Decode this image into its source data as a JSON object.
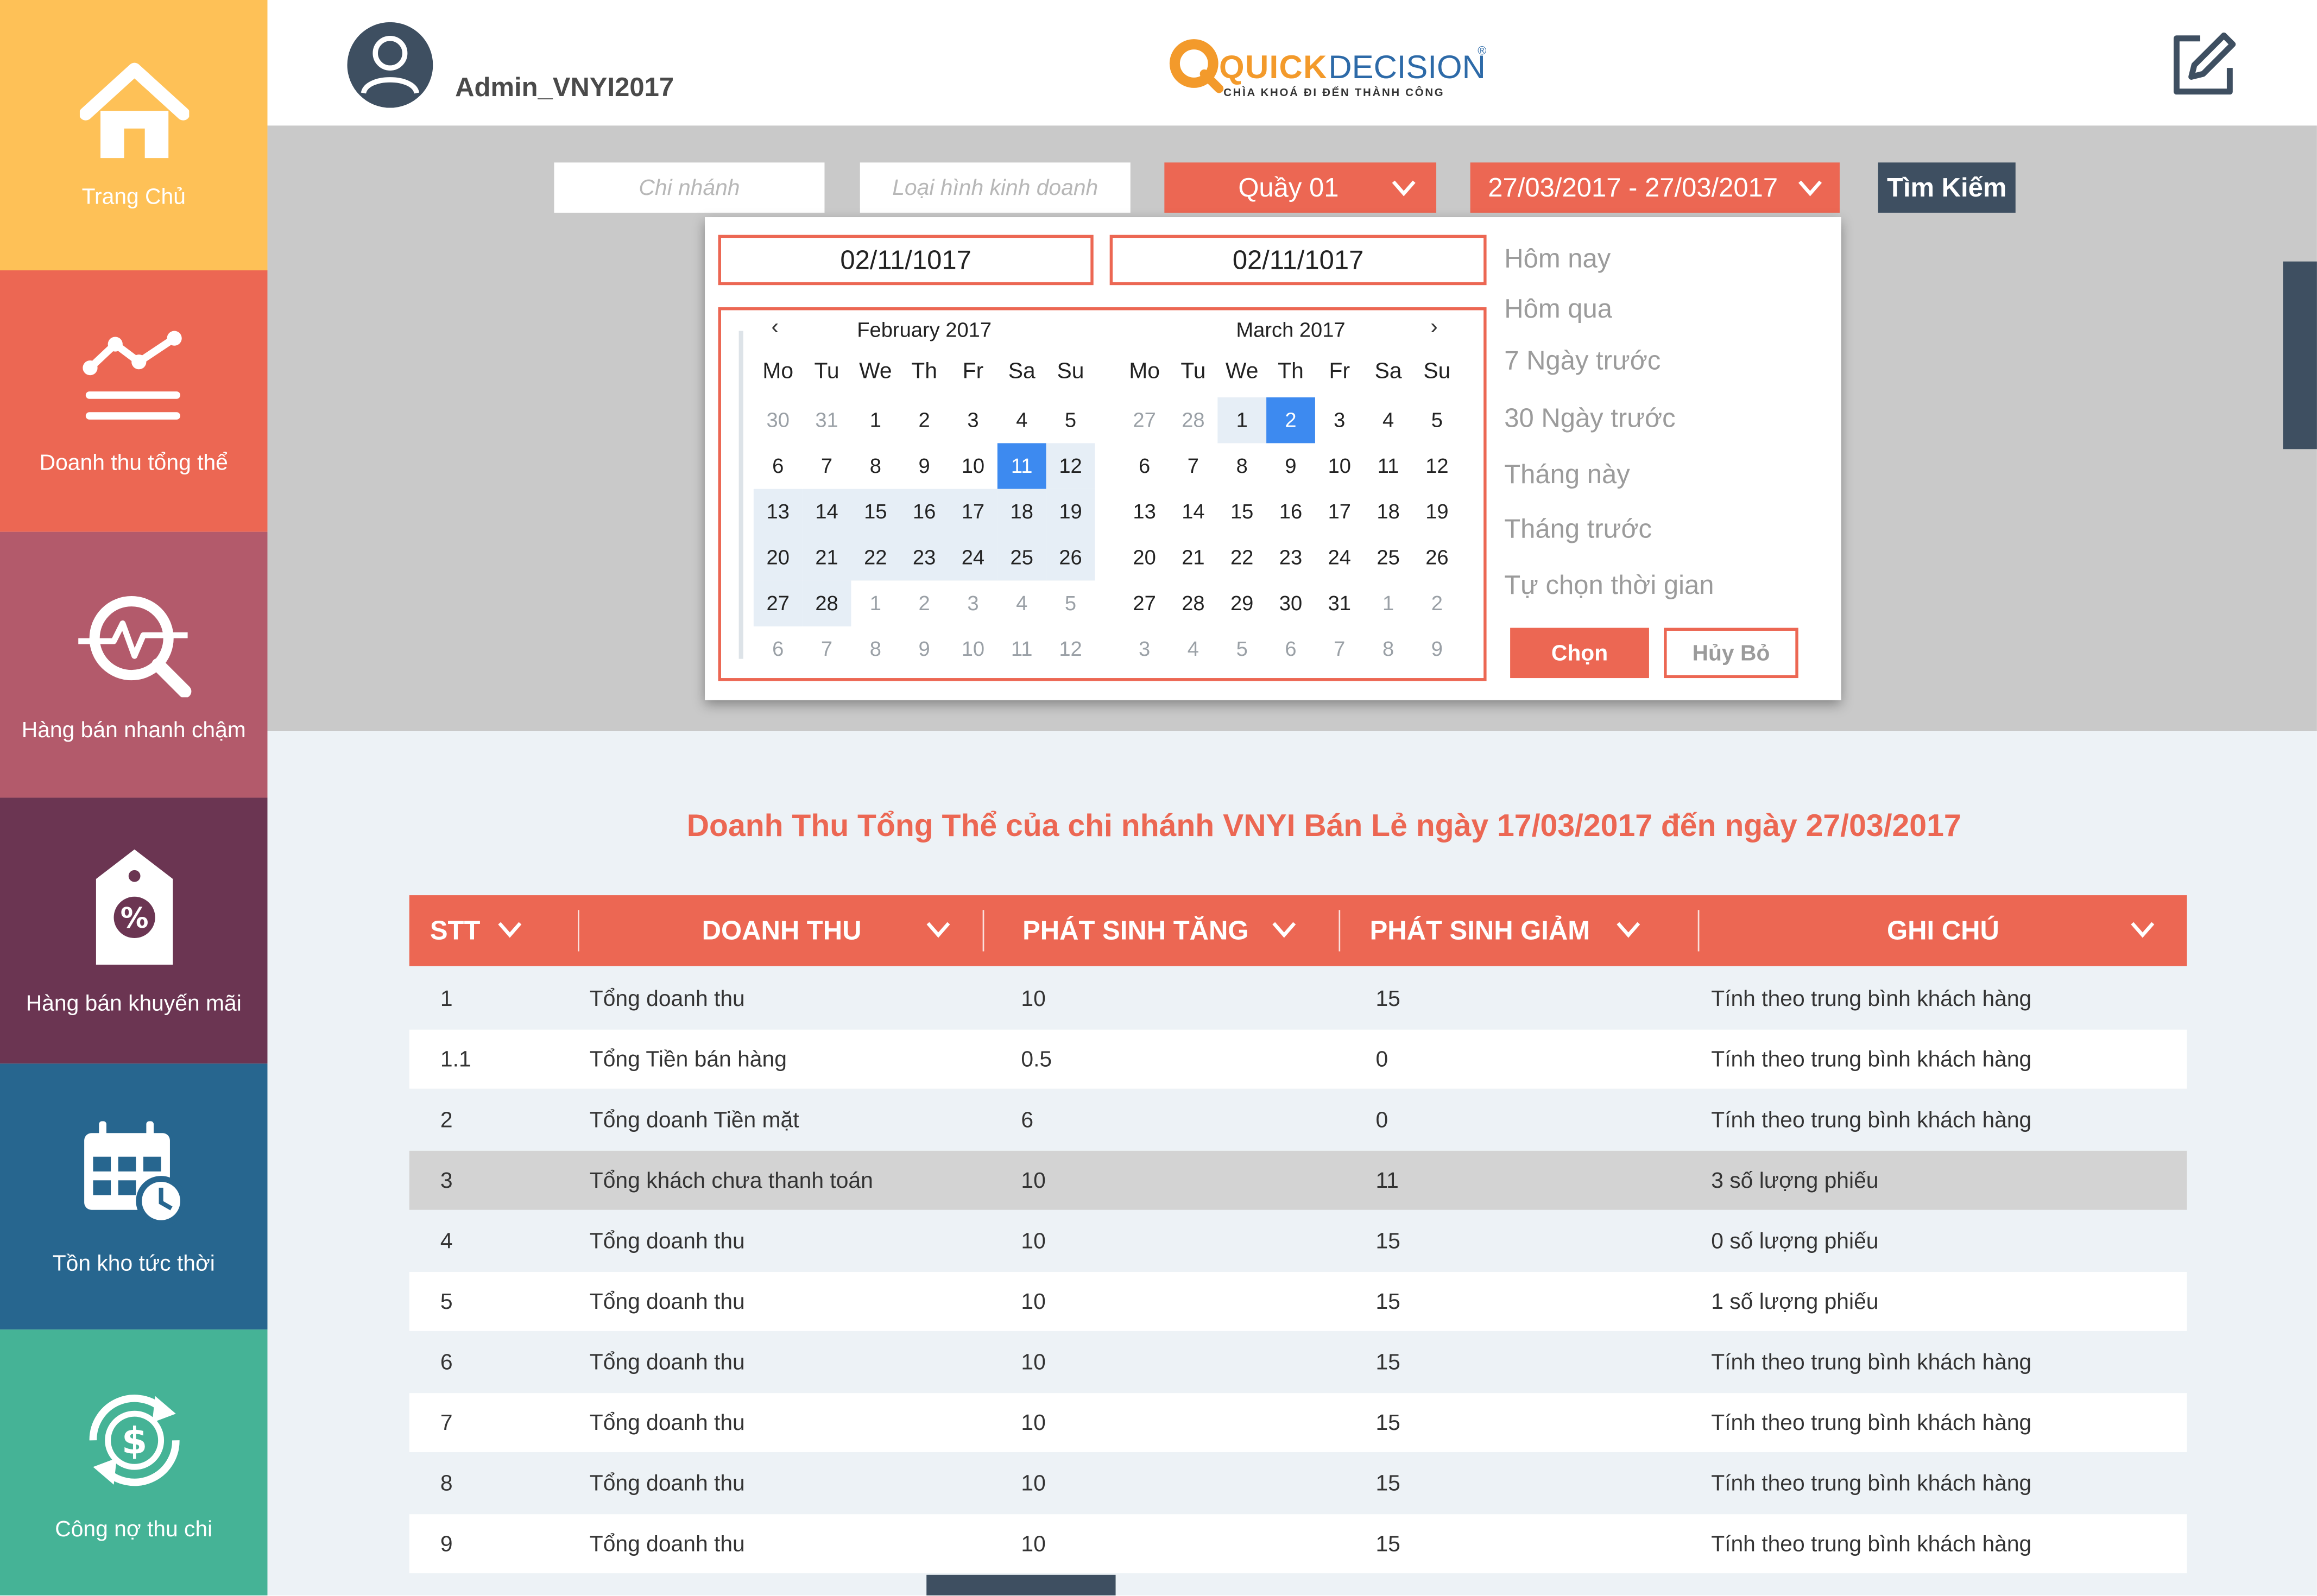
{
  "sidebar": {
    "items": [
      {
        "label": "Trang Chủ",
        "icon": "home-icon",
        "color": "#fec157"
      },
      {
        "label": "Doanh thu tổng thể",
        "icon": "chart-line-icon",
        "color": "#ec6753"
      },
      {
        "label": "Hàng bán nhanh chậm",
        "icon": "search-pulse-icon",
        "color": "#b35a6b"
      },
      {
        "label": "Hàng bán khuyến mãi",
        "icon": "discount-tag-icon",
        "color": "#6b3552"
      },
      {
        "label": "Tồn kho tức thời",
        "icon": "calendar-clock-icon",
        "color": "#27668f"
      },
      {
        "label": "Công nợ thu chi",
        "icon": "money-cycle-icon",
        "color": "#45b396"
      }
    ]
  },
  "header": {
    "username": "Admin_VNYI2017",
    "logo_brand_a": "QUICK",
    "logo_brand_b": "DECISION",
    "logo_tagline": "CHÌA KHOÁ ĐI ĐẾN THÀNH CÔNG",
    "edit_icon": "edit-icon"
  },
  "filters": {
    "branch_placeholder": "Chi nhánh",
    "business_type_placeholder": "Loại hình kinh doanh",
    "counter": "Quầy 01",
    "date_range": "27/03/2017 - 27/03/2017",
    "search_button": "Tìm Kiếm"
  },
  "datepicker": {
    "start_input": "02/11/1017",
    "end_input": "02/11/1017",
    "weekdays": [
      "Mo",
      "Tu",
      "We",
      "Th",
      "Fr",
      "Sa",
      "Su"
    ],
    "left_month": {
      "title": "February 2017",
      "prev": "‹",
      "weeks": [
        [
          "30",
          "31",
          "1",
          "2",
          "3",
          "4",
          "5"
        ],
        [
          "6",
          "7",
          "8",
          "9",
          "10",
          "11",
          "12"
        ],
        [
          "13",
          "14",
          "15",
          "16",
          "17",
          "18",
          "19"
        ],
        [
          "20",
          "21",
          "22",
          "23",
          "24",
          "25",
          "26"
        ],
        [
          "27",
          "28",
          "1",
          "2",
          "3",
          "4",
          "5"
        ],
        [
          "6",
          "7",
          "8",
          "9",
          "10",
          "11",
          "12"
        ]
      ]
    },
    "right_month": {
      "title": "March 2017",
      "next": "›",
      "weeks": [
        [
          "27",
          "28",
          "1",
          "2",
          "3",
          "4",
          "5"
        ],
        [
          "6",
          "7",
          "8",
          "9",
          "10",
          "11",
          "12"
        ],
        [
          "13",
          "14",
          "15",
          "16",
          "17",
          "18",
          "19"
        ],
        [
          "20",
          "21",
          "22",
          "23",
          "24",
          "25",
          "26"
        ],
        [
          "27",
          "28",
          "29",
          "30",
          "31",
          "1",
          "2"
        ],
        [
          "3",
          "4",
          "5",
          "6",
          "7",
          "8",
          "9"
        ]
      ]
    },
    "quick_ranges": [
      "Hôm nay",
      "Hôm qua",
      "7 Ngày trước",
      "30 Ngày trước",
      "Tháng này",
      "Tháng trước",
      "Tự chọn thời gian"
    ],
    "apply_button": "Chọn",
    "cancel_button": "Hủy Bỏ"
  },
  "report": {
    "title": "Doanh Thu Tổng Thể của chi nhánh VNYI Bán Lẻ ngày 17/03/2017 đến ngày 27/03/2017",
    "columns": [
      "STT",
      "DOANH THU",
      "PHÁT SINH TĂNG",
      "PHÁT SINH GIẢM",
      "GHI CHÚ"
    ],
    "rows": [
      [
        "1",
        "Tổng doanh thu",
        "10",
        "15",
        "Tính theo trung bình khách hàng"
      ],
      [
        "1.1",
        "Tổng Tiền bán hàng",
        "0.5",
        "0",
        "Tính theo trung bình khách hàng"
      ],
      [
        "2",
        "Tổng doanh Tiền mặt",
        "6",
        "0",
        "Tính theo trung bình khách hàng"
      ],
      [
        "3",
        "Tổng khách chưa thanh toán",
        "10",
        "11",
        "3 số lượng phiếu"
      ],
      [
        "4",
        "Tổng doanh thu",
        "10",
        "15",
        "0 số lượng phiếu"
      ],
      [
        "5",
        "Tổng doanh thu",
        "10",
        "15",
        "1 số lượng phiếu"
      ],
      [
        "6",
        "Tổng doanh thu",
        "10",
        "15",
        "Tính theo trung bình khách hàng"
      ],
      [
        "7",
        "Tổng doanh thu",
        "10",
        "15",
        "Tính theo trung bình khách hàng"
      ],
      [
        "8",
        "Tổng doanh thu",
        "10",
        "15",
        "Tính theo trung bình khách hàng"
      ],
      [
        "9",
        "Tổng doanh thu",
        "10",
        "15",
        "Tính theo trung bình khách hàng"
      ]
    ]
  },
  "colors": {
    "accent": "#ec6753",
    "dark": "#3e4f61",
    "selected_day": "#3d8af0",
    "range_day": "#e6eef6"
  }
}
